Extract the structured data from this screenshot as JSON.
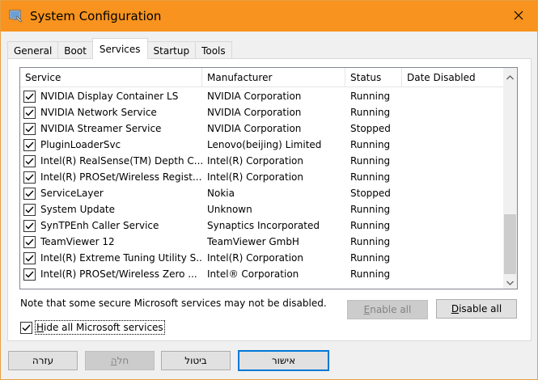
{
  "window": {
    "title": "System Configuration",
    "icon": "msconfig-icon",
    "close": "close-icon"
  },
  "tabs": [
    {
      "label": "General",
      "active": false
    },
    {
      "label": "Boot",
      "active": false
    },
    {
      "label": "Services",
      "active": true
    },
    {
      "label": "Startup",
      "active": false
    },
    {
      "label": "Tools",
      "active": false
    }
  ],
  "services": {
    "columns": {
      "service": "Service",
      "manufacturer": "Manufacturer",
      "status": "Status",
      "date_disabled": "Date Disabled"
    },
    "rows": [
      {
        "checked": true,
        "service": "NVIDIA Display Container LS",
        "manufacturer": "NVIDIA Corporation",
        "status": "Running",
        "date_disabled": ""
      },
      {
        "checked": true,
        "service": "NVIDIA Network Service",
        "manufacturer": "NVIDIA Corporation",
        "status": "Running",
        "date_disabled": ""
      },
      {
        "checked": true,
        "service": "NVIDIA Streamer Service",
        "manufacturer": "NVIDIA Corporation",
        "status": "Stopped",
        "date_disabled": ""
      },
      {
        "checked": true,
        "service": "PluginLoaderSvc",
        "manufacturer": "Lenovo(beijing) Limited",
        "status": "Running",
        "date_disabled": ""
      },
      {
        "checked": true,
        "service": "Intel(R) RealSense(TM) Depth C...",
        "manufacturer": "Intel(R) Corporation",
        "status": "Running",
        "date_disabled": ""
      },
      {
        "checked": true,
        "service": "Intel(R) PROSet/Wireless Regist...",
        "manufacturer": "Intel(R) Corporation",
        "status": "Running",
        "date_disabled": ""
      },
      {
        "checked": true,
        "service": "ServiceLayer",
        "manufacturer": "Nokia",
        "status": "Stopped",
        "date_disabled": ""
      },
      {
        "checked": true,
        "service": "System Update",
        "manufacturer": "Unknown",
        "status": "Running",
        "date_disabled": ""
      },
      {
        "checked": true,
        "service": "SynTPEnh Caller Service",
        "manufacturer": "Synaptics Incorporated",
        "status": "Running",
        "date_disabled": ""
      },
      {
        "checked": true,
        "service": "TeamViewer 12",
        "manufacturer": "TeamViewer GmbH",
        "status": "Running",
        "date_disabled": ""
      },
      {
        "checked": true,
        "service": "Intel(R) Extreme Tuning Utility S...",
        "manufacturer": "Intel(R) Corporation",
        "status": "Running",
        "date_disabled": ""
      },
      {
        "checked": true,
        "service": "Intel(R) PROSet/Wireless Zero ...",
        "manufacturer": "Intel® Corporation",
        "status": "Running",
        "date_disabled": ""
      }
    ]
  },
  "note": "Note that some secure Microsoft services may not be disabled.",
  "enable_all": {
    "mnemonic": "E",
    "rest": "nable all",
    "enabled": false
  },
  "disable_all": {
    "mnemonic": "D",
    "rest": "isable all",
    "enabled": true
  },
  "hide_ms": {
    "checked": true,
    "mnemonic": "H",
    "rest": "ide all Microsoft services"
  },
  "footer": {
    "ok": "אישור",
    "cancel": "ביטול",
    "apply_mnemonic": "ה",
    "apply_rest": "חל",
    "help": "עזרה"
  },
  "colors": {
    "titlebar": "#f7931e",
    "focus_border": "#0078d7"
  }
}
